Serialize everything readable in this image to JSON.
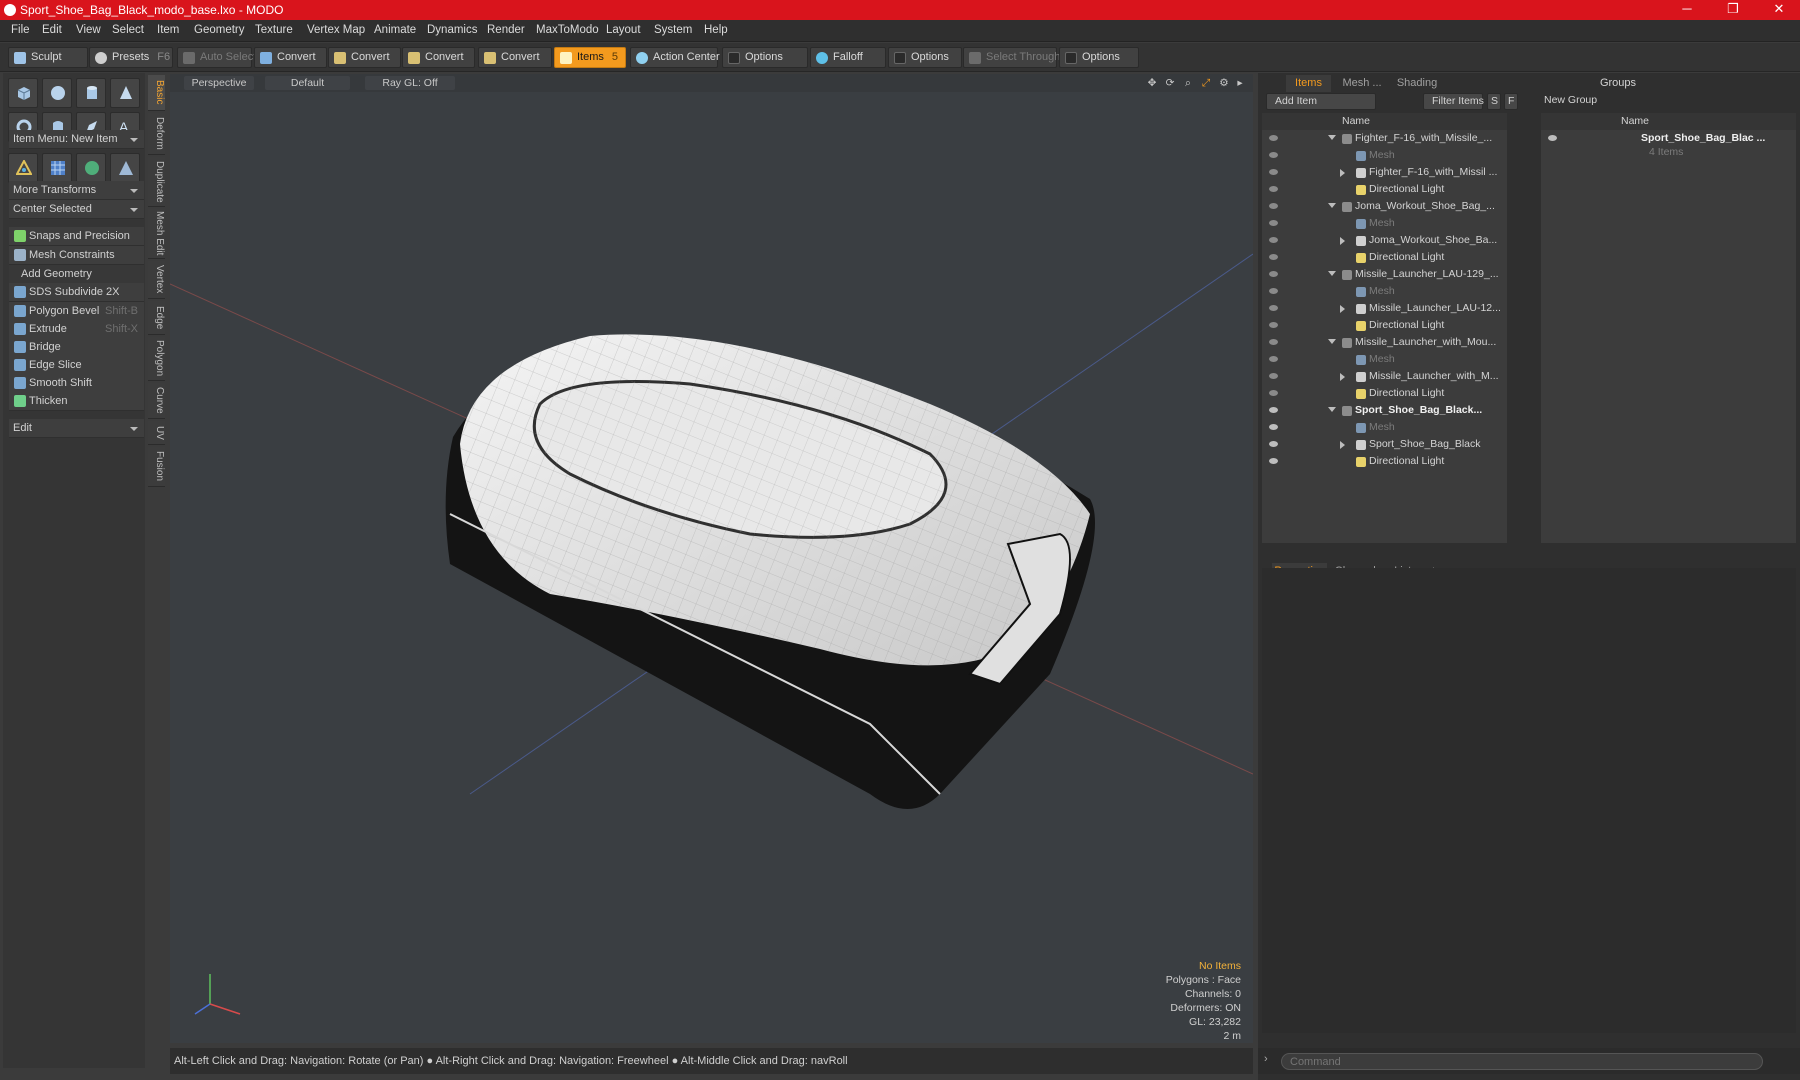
{
  "window": {
    "title": "Sport_Shoe_Bag_Black_modo_base.lxo - MODO",
    "minimize": "─",
    "maximize": "❐",
    "close": "✕"
  },
  "menu": [
    "File",
    "Edit",
    "View",
    "Select",
    "Item",
    "Geometry",
    "Texture",
    "Vertex Map",
    "Animate",
    "Dynamics",
    "Render",
    "MaxToModo",
    "Layout",
    "System",
    "Help"
  ],
  "toolbar": {
    "sculpt": "Sculpt",
    "presets": "Presets",
    "presets_shortcut": "F6",
    "auto_select": "Auto Select",
    "convert": [
      "Convert",
      "Convert",
      "Convert",
      "Convert"
    ],
    "items": "Items",
    "items_shortcut": "5",
    "action_center": "Action Center",
    "options": "Options",
    "falloff": "Falloff",
    "options2": "Options",
    "select_through": "Select Through",
    "options3": "Options"
  },
  "left_panel": {
    "item_menu": "Item Menu: New Item",
    "more_transforms": "More Transforms",
    "center_selected": "Center Selected",
    "snaps": "Snaps and Precision",
    "mesh_constraints": "Mesh Constraints",
    "add_geometry": "Add Geometry",
    "tools": [
      {
        "label": "SDS Subdivide 2X",
        "shortcut": ""
      },
      {
        "label": "Polygon Bevel",
        "shortcut": "Shift-B"
      },
      {
        "label": "Extrude",
        "shortcut": "Shift-X"
      },
      {
        "label": "Bridge",
        "shortcut": ""
      },
      {
        "label": "Edge Slice",
        "shortcut": ""
      },
      {
        "label": "Smooth Shift",
        "shortcut": ""
      },
      {
        "label": "Thicken",
        "shortcut": ""
      }
    ],
    "edit": "Edit",
    "vertical_tabs": [
      "Basic",
      "Deform",
      "Duplicate",
      "Mesh Edit",
      "Vertex",
      "Edge",
      "Polygon",
      "Curve",
      "UV",
      "Fusion"
    ]
  },
  "viewport": {
    "header": {
      "view": "Perspective",
      "shading": "Default",
      "raygl": "Ray GL: Off"
    },
    "info": {
      "items": "No Items",
      "polygons": "Polygons : Face",
      "channels": "Channels: 0",
      "deformers": "Deformers: ON",
      "gl": "GL: 23,282",
      "scale": "2 m"
    }
  },
  "status_bar": "Alt-Left Click and Drag: Navigation: Rotate (or Pan) ● Alt-Right Click and Drag: Navigation: Freewheel ● Alt-Middle Click and Drag: navRoll",
  "items_panel": {
    "tabs": [
      "Items",
      "Mesh ...",
      "Shading"
    ],
    "add_item": "Add Item",
    "filter_items": "Filter Items",
    "s_btn": "S",
    "f_btn": "F",
    "name_col": "Name",
    "rows": [
      {
        "label": "Fighter_F-16_with_Missile_...",
        "type": "scene"
      },
      {
        "label": "Mesh",
        "type": "mesh"
      },
      {
        "label": "Fighter_F-16_with_Missil ...",
        "type": "group"
      },
      {
        "label": "Directional Light",
        "type": "light"
      },
      {
        "label": "Joma_Workout_Shoe_Bag_...",
        "type": "scene"
      },
      {
        "label": "Mesh",
        "type": "mesh"
      },
      {
        "label": "Joma_Workout_Shoe_Ba...",
        "type": "group"
      },
      {
        "label": "Directional Light",
        "type": "light"
      },
      {
        "label": "Missile_Launcher_LAU-129_...",
        "type": "scene"
      },
      {
        "label": "Mesh",
        "type": "mesh"
      },
      {
        "label": "Missile_Launcher_LAU-12...",
        "type": "group"
      },
      {
        "label": "Directional Light",
        "type": "light"
      },
      {
        "label": "Missile_Launcher_with_Mou...",
        "type": "scene"
      },
      {
        "label": "Mesh",
        "type": "mesh"
      },
      {
        "label": "Missile_Launcher_with_M...",
        "type": "group"
      },
      {
        "label": "Directional Light",
        "type": "light"
      },
      {
        "label": "Sport_Shoe_Bag_Black...",
        "type": "scene_active"
      },
      {
        "label": "Mesh",
        "type": "mesh"
      },
      {
        "label": "Sport_Shoe_Bag_Black",
        "type": "group"
      },
      {
        "label": "Directional Light",
        "type": "light"
      }
    ]
  },
  "groups_panel": {
    "title": "Groups",
    "new_group": "New Group",
    "name_col": "Name",
    "group_name": "Sport_Shoe_Bag_Blac ...",
    "group_count": "4 Items"
  },
  "props_panel": {
    "tabs": [
      "Properties",
      "Channels",
      "Lists"
    ],
    "add": "+"
  },
  "command": {
    "placeholder": "Command"
  },
  "colors": {
    "accent": "#f39a1e",
    "title_bar": "#d9141c"
  }
}
